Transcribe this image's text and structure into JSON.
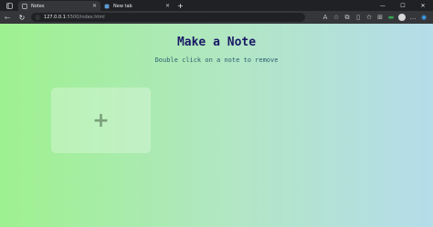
{
  "browser": {
    "tabs": [
      {
        "label": "Notes",
        "active": true
      },
      {
        "label": "New tab",
        "active": false
      }
    ],
    "new_tab_symbol": "+",
    "window_controls": {
      "minimize": "—",
      "maximize": "☐",
      "close": "✕"
    },
    "toolbar": {
      "back": "←",
      "reload": "↻",
      "url_host": "127.0.0.1",
      "url_path": ":5500/index.html",
      "icons": [
        "read-aloud-icon",
        "favorite-star-icon",
        "extension-icon",
        "split-screen-icon",
        "favorites-icon",
        "collections-icon",
        "green-extension-icon",
        "profile-avatar",
        "settings-more-icon",
        "edge-copilot-icon"
      ]
    }
  },
  "page": {
    "title": "Make a Note",
    "subtitle": "Double click on a note to remove",
    "add_note_symbol": "+",
    "colors": {
      "gradient_start": "#9ef18f",
      "gradient_end": "#b4dcea",
      "title": "#1a1a66",
      "subtitle": "#2f5e6e"
    }
  }
}
